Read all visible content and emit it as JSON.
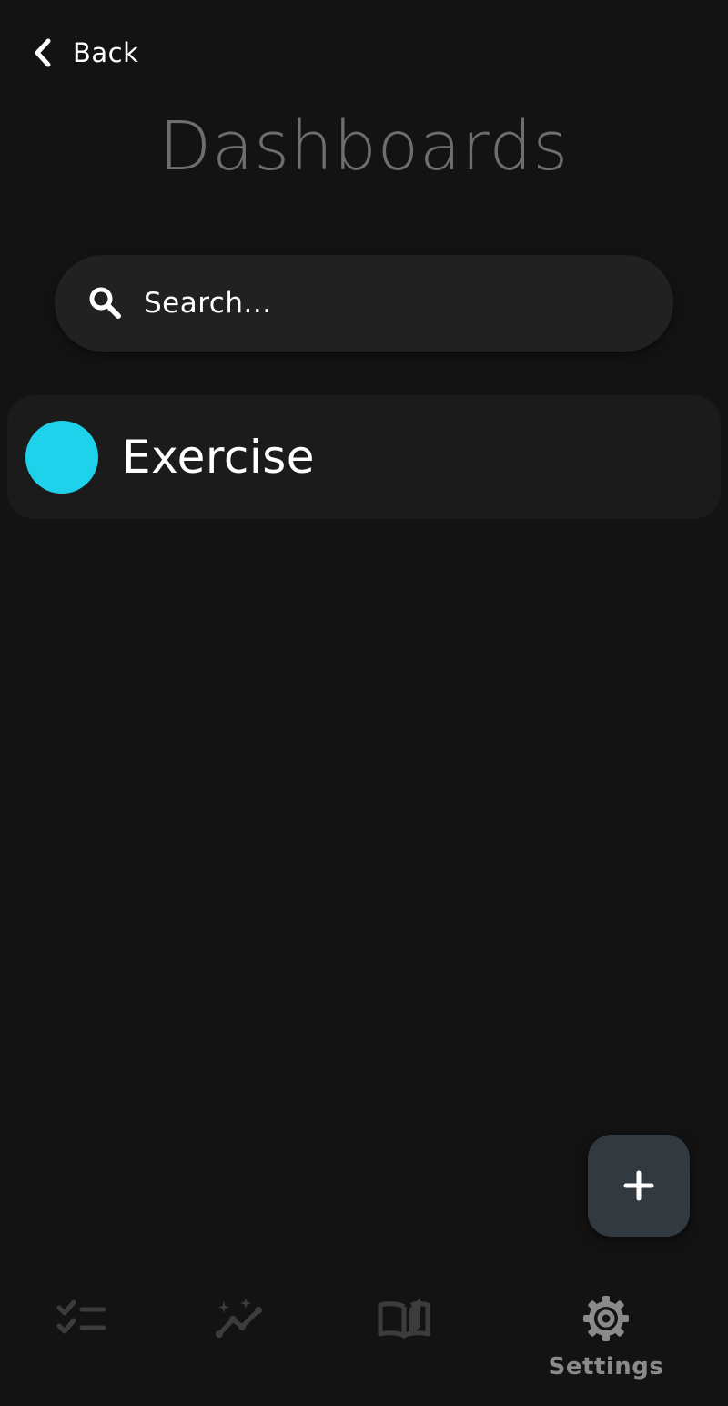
{
  "header": {
    "back_label": "Back",
    "title": "Dashboards",
    "back_icon": "chevron-left-icon"
  },
  "search": {
    "placeholder": "Search...",
    "value": "",
    "icon": "search-icon"
  },
  "dashboards": [
    {
      "name": "Exercise",
      "color": "#1ed2ec"
    }
  ],
  "fab": {
    "icon": "plus-icon"
  },
  "bottom_nav": {
    "items": [
      {
        "id": "tasks",
        "icon": "checklist-icon",
        "label": "",
        "active": false
      },
      {
        "id": "insights",
        "icon": "sparkle-chart-icon",
        "label": "",
        "active": false
      },
      {
        "id": "journal",
        "icon": "book-icon",
        "label": "",
        "active": false
      },
      {
        "id": "settings",
        "icon": "gear-icon",
        "label": "Settings",
        "active": true
      }
    ]
  },
  "colors": {
    "background": "#131313",
    "title": "#6e6e72",
    "search_bg": "#212121",
    "card_bg": "#1b1b1b",
    "fab_bg": "#323a40",
    "nav_icon_inactive": "#3c3c3c",
    "nav_icon_active": "#8a8a8a"
  }
}
